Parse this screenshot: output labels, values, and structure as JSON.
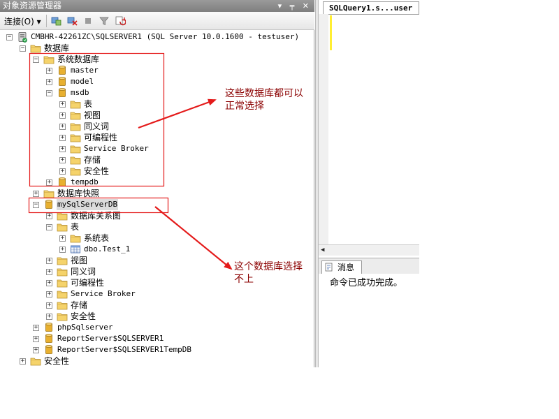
{
  "panel": {
    "title": "对象资源管理器",
    "controls": "▾ ╤ ✕"
  },
  "toolbar": {
    "connect_label": "连接(O) ▾"
  },
  "tree": {
    "server": "CMBHR-42261ZC\\SQLSERVER1 (SQL Server 10.0.1600 - testuser)",
    "databases": "数据库",
    "system_databases": "系统数据库",
    "master": "master",
    "model": "model",
    "msdb": "msdb",
    "msdb_tables": "表",
    "msdb_views": "视图",
    "msdb_synonyms": "同义词",
    "msdb_programmability": "可编程性",
    "msdb_service_broker": "Service Broker",
    "msdb_storage": "存储",
    "msdb_security": "安全性",
    "tempdb": "tempdb",
    "snapshots": "数据库快照",
    "mysql_db": "mySqlServerDB",
    "diagrams": "数据库关系图",
    "tables": "表",
    "system_tables": "系统表",
    "test_table": "dbo.Test_1",
    "views": "视图",
    "synonyms": "同义词",
    "programmability": "可编程性",
    "service_broker": "Service Broker",
    "storage": "存储",
    "security_db": "安全性",
    "php_db": "phpSqlserver",
    "report_db": "ReportServer$SQLSERVER1",
    "report_temp_db": "ReportServer$SQLSERVER1TempDB",
    "server_security": "安全性"
  },
  "editor": {
    "tab_label": "SQLQuery1.s...user"
  },
  "results": {
    "messages_tab": "消息",
    "message": "命令已成功完成。"
  },
  "annotations": {
    "ok_line1": "这些数据库都可以",
    "ok_line2": "正常选择",
    "fail_line1": "这个数据库选择",
    "fail_line2": "不上"
  },
  "colors": {
    "annotation_red": "#e41a1a",
    "annotation_text": "#8b0000",
    "folder_yellow": "#f5d36b",
    "db_yellow": "#e8b030"
  }
}
